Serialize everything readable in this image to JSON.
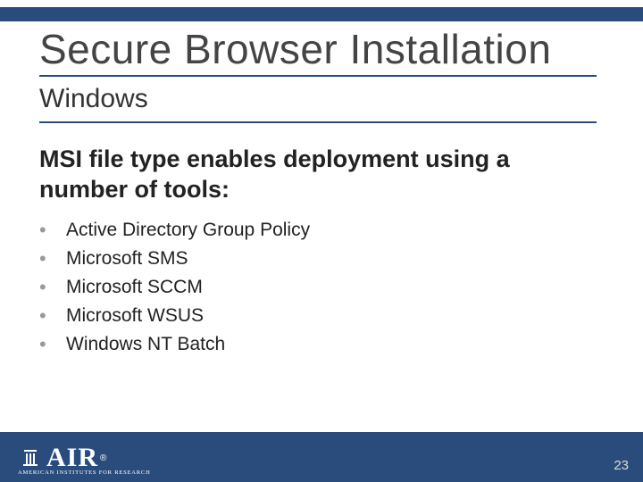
{
  "colors": {
    "brand": "#2a4c7d"
  },
  "header": {
    "title": "Secure Browser Installation",
    "subtitle": "Windows"
  },
  "body": {
    "heading": "MSI file type enables deployment using a number of tools:",
    "bullets": [
      "Active Directory Group Policy",
      "Microsoft SMS",
      "Microsoft SCCM",
      "Microsoft WSUS",
      "Windows NT Batch"
    ]
  },
  "footer": {
    "logo_text": "AIR",
    "logo_reg": "®",
    "logo_sub": "AMERICAN INSTITUTES FOR RESEARCH",
    "page_number": "23"
  }
}
